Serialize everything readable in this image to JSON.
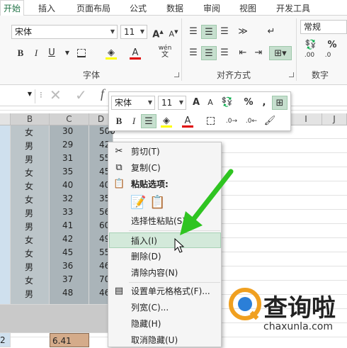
{
  "ribbon_tabs": [
    "开始",
    "插入",
    "页面布局",
    "公式",
    "数据",
    "审阅",
    "视图",
    "开发工具"
  ],
  "ribbon": {
    "font_name": "宋体",
    "font_size": "11",
    "number_format": "常规",
    "group_font": "字体",
    "group_align": "对齐方式",
    "group_number": "数字",
    "bold": "B",
    "italic": "I",
    "underline": "U",
    "grow": "A",
    "shrink": "A",
    "wen": "wén",
    "percent": "%",
    "comma": ",",
    "dec_inc": ".00",
    "dec_dec": ".0"
  },
  "formula_bar": {
    "fx": "f"
  },
  "columns": [
    "B",
    "C",
    "D",
    "I",
    "J"
  ],
  "rows": [
    {
      "b": "女",
      "c": "30",
      "d": "500"
    },
    {
      "b": "男",
      "c": "29",
      "d": "42"
    },
    {
      "b": "男",
      "c": "31",
      "d": "55"
    },
    {
      "b": "女",
      "c": "35",
      "d": "45"
    },
    {
      "b": "女",
      "c": "40",
      "d": "40"
    },
    {
      "b": "女",
      "c": "32",
      "d": "35"
    },
    {
      "b": "男",
      "c": "33",
      "d": "56"
    },
    {
      "b": "男",
      "c": "41",
      "d": "60"
    },
    {
      "b": "女",
      "c": "42",
      "d": "49"
    },
    {
      "b": "女",
      "c": "45",
      "d": "55"
    },
    {
      "b": "男",
      "c": "36",
      "d": "46"
    },
    {
      "b": "女",
      "c": "37",
      "d": "70"
    },
    {
      "b": "男",
      "c": "48",
      "d": "46"
    }
  ],
  "bottom_row": {
    "a": "2",
    "c": "6.41"
  },
  "mini_toolbar": {
    "font_name": "宋体",
    "font_size": "11",
    "bold": "B",
    "italic": "I",
    "percent": "%",
    "comma": ",",
    "grow": "A",
    "shrink": "A",
    "font_color_a": "A"
  },
  "context_menu": {
    "items": [
      "剪切(T)",
      "复制(C)",
      "粘贴选项:",
      "选择性粘贴(S)...",
      "插入(I)",
      "删除(D)",
      "清除内容(N)",
      "设置单元格格式(F)...",
      "列宽(C)...",
      "隐藏(H)",
      "取消隐藏(U)"
    ]
  },
  "watermark": {
    "brand": "查询啦",
    "url": "chaxunla.com"
  },
  "colors": {
    "accent": "#217346",
    "highlight": "#d3e9da",
    "arrow": "#2fc421",
    "gray_cell": "#bcc5c9",
    "tan_cell": "#d4ab8a"
  }
}
